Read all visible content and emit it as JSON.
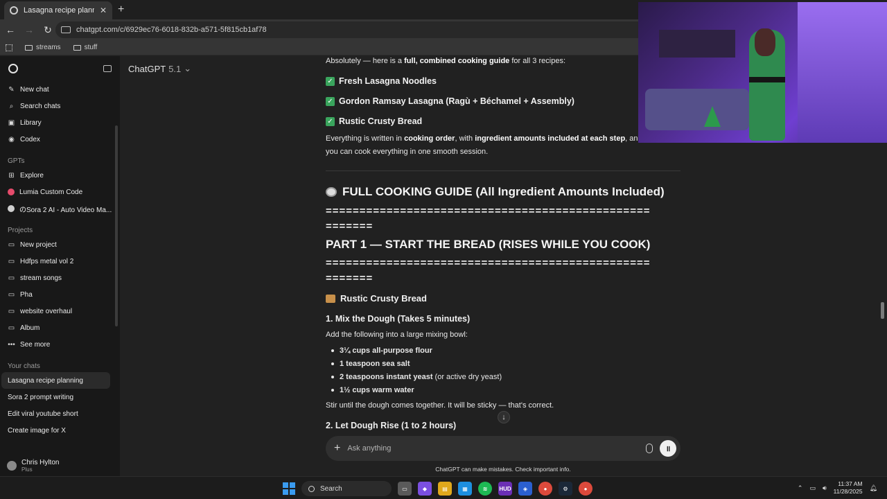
{
  "browser": {
    "tab_title": "Lasagna recipe planning",
    "url": "chatgpt.com/c/6929ec76-6018-832b-a571-5f815cb1af78",
    "bookmarks": [
      "streams",
      "stuff"
    ]
  },
  "sidebar": {
    "top_items": [
      {
        "label": "New chat",
        "icon": "compose-icon"
      },
      {
        "label": "Search chats",
        "icon": "search-icon"
      },
      {
        "label": "Library",
        "icon": "library-icon"
      },
      {
        "label": "Codex",
        "icon": "codex-icon"
      }
    ],
    "gpts_heading": "GPTs",
    "gpts": [
      {
        "label": "Explore",
        "icon": "grid-icon"
      },
      {
        "label": "Lumia Custom Code",
        "icon": "gpt-avatar-icon"
      },
      {
        "label": "のSora 2 AI - Auto Video Ma...",
        "icon": "gpt-avatar-icon"
      }
    ],
    "projects_heading": "Projects",
    "projects": [
      {
        "label": "New project"
      },
      {
        "label": "Hdfps metal vol 2"
      },
      {
        "label": "stream songs"
      },
      {
        "label": "Pha"
      },
      {
        "label": "website overhaul"
      },
      {
        "label": "Album"
      }
    ],
    "see_more": "See more",
    "chats_heading": "Your chats",
    "chats": [
      {
        "label": "Lasagna recipe planning"
      },
      {
        "label": "Sora 2 prompt writing"
      },
      {
        "label": "Edit viral youtube short"
      },
      {
        "label": "Create image for X"
      }
    ],
    "user": {
      "name": "Chris Hylton",
      "plan": "Plus"
    }
  },
  "header": {
    "model_name": "ChatGPT",
    "model_version": "5.1"
  },
  "message": {
    "intro_pre": "Absolutely — here is a ",
    "intro_b1": "full, combined cooking guide",
    "intro_post": " for all 3 recipes:",
    "checks": [
      "Fresh Lasagna Noodles",
      "Gordon Ramsay Lasagna (Ragù + Béchamel + Assembly)",
      "Rustic Crusty Bread"
    ],
    "written_pre": "Everything is written in ",
    "written_b1": "cooking order",
    "written_mid": ", with ",
    "written_b2": "ingredient amounts included at each step",
    "written_post": ", and stru",
    "written_line2": "you can cook everything in one smooth session.",
    "guide_title": "FULL COOKING GUIDE (All Ingredient Amounts Included)",
    "equals_long": "================================================",
    "equals_short": "=======",
    "part1_title": "PART 1 — START THE BREAD (RISES WHILE YOU COOK)",
    "bread_title": "Rustic Crusty Bread",
    "step1_title": "1. Mix the Dough (Takes 5 minutes)",
    "step1_intro": "Add the following into a large mixing bowl:",
    "ingredients": [
      {
        "bold": "3¼ cups all-purpose flour",
        "rest": ""
      },
      {
        "bold": "1 teaspoon sea salt",
        "rest": ""
      },
      {
        "bold": "2 teaspoons instant yeast",
        "rest": " (or active dry yeast)"
      },
      {
        "bold": "1½ cups warm water",
        "rest": ""
      }
    ],
    "stir_text": "Stir until the dough comes together. It will be sticky — that's correct.",
    "step2_title": "2. Let Dough Rise (1 to 2 hours)"
  },
  "composer": {
    "placeholder": "Ask anything"
  },
  "disclaimer": "ChatGPT can make mistakes. Check important info.",
  "taskbar": {
    "search_label": "Search",
    "time": "11:37 AM",
    "date": "11/28/2025"
  },
  "colors": {
    "accent_green": "#3aa55d",
    "windows_blue": "#3a9bf0"
  }
}
